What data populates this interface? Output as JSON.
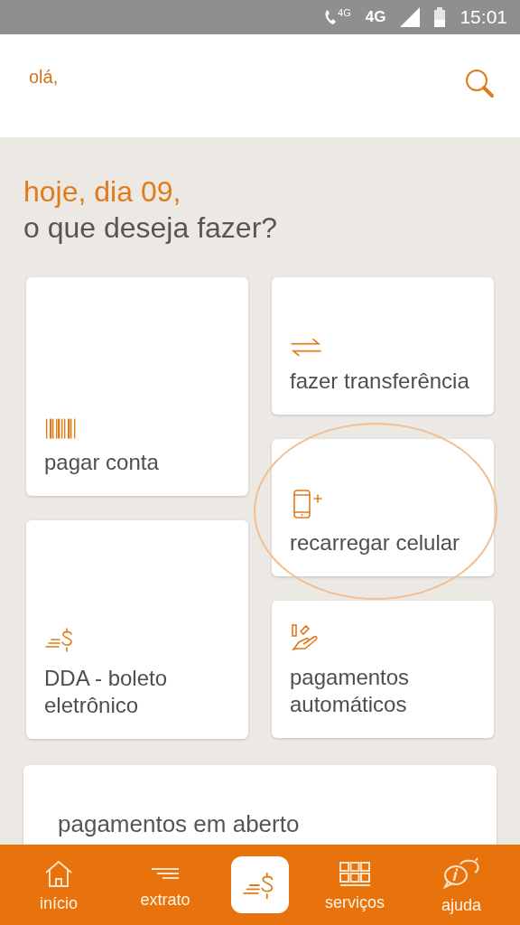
{
  "status_bar": {
    "call_badge": "4G",
    "network": "4G",
    "time": "15:01"
  },
  "header": {
    "greeting": "olá,"
  },
  "heading": {
    "date_line": "hoje, dia 09,",
    "question": "o que deseja fazer?"
  },
  "left_actions": [
    {
      "label": "pagar conta",
      "highlighted": false
    },
    {
      "label": "DDA - boleto eletrônico",
      "highlighted": false
    }
  ],
  "right_actions": [
    {
      "label": "fazer transferência",
      "highlighted": false
    },
    {
      "label": "recarregar celular",
      "highlighted": true
    },
    {
      "label": "pagamentos automáticos",
      "highlighted": false
    }
  ],
  "open_payments": {
    "title": "pagamentos em aberto"
  },
  "bottom_nav": [
    {
      "kind": "tab",
      "label": "início"
    },
    {
      "kind": "tab",
      "label": "extrato"
    },
    {
      "kind": "center"
    },
    {
      "kind": "tab",
      "label": "serviços"
    },
    {
      "kind": "tab",
      "label": "ajuda"
    }
  ]
}
